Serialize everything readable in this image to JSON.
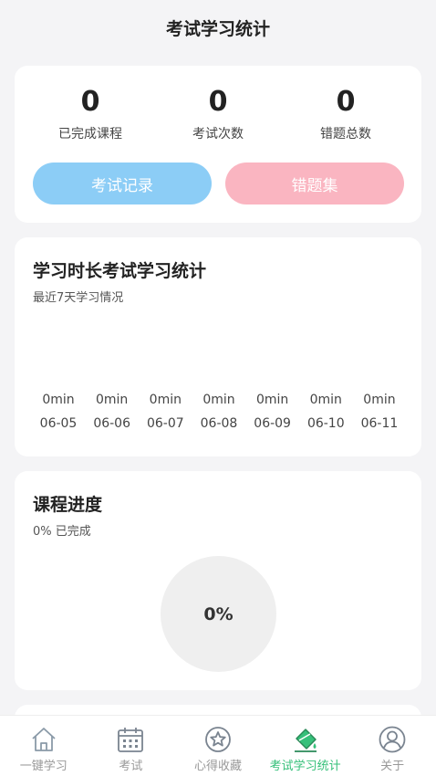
{
  "header": {
    "title": "考试学习统计"
  },
  "stats": {
    "items": [
      {
        "value": "0",
        "label": "已完成课程"
      },
      {
        "value": "0",
        "label": "考试次数"
      },
      {
        "value": "0",
        "label": "错题总数"
      }
    ],
    "exam_record_label": "考试记录",
    "wrong_set_label": "错题集"
  },
  "study_time": {
    "title": "学习时长考试学习统计",
    "subtitle": "最近7天学习情况",
    "days": [
      {
        "mins": "0min",
        "date": "06-05"
      },
      {
        "mins": "0min",
        "date": "06-06"
      },
      {
        "mins": "0min",
        "date": "06-07"
      },
      {
        "mins": "0min",
        "date": "06-08"
      },
      {
        "mins": "0min",
        "date": "06-09"
      },
      {
        "mins": "0min",
        "date": "06-10"
      },
      {
        "mins": "0min",
        "date": "06-11"
      }
    ]
  },
  "progress": {
    "title": "课程进度",
    "subtitle": "0% 已完成",
    "percent": "0%"
  },
  "tabbar": {
    "active_color": "#36c07a",
    "items": [
      {
        "label": "一键学习",
        "icon": "home-icon"
      },
      {
        "label": "考试",
        "icon": "calendar-icon"
      },
      {
        "label": "心得收藏",
        "icon": "star-icon"
      },
      {
        "label": "考试学习统计",
        "icon": "paint-bucket-icon"
      },
      {
        "label": "关于",
        "icon": "user-icon"
      }
    ]
  }
}
